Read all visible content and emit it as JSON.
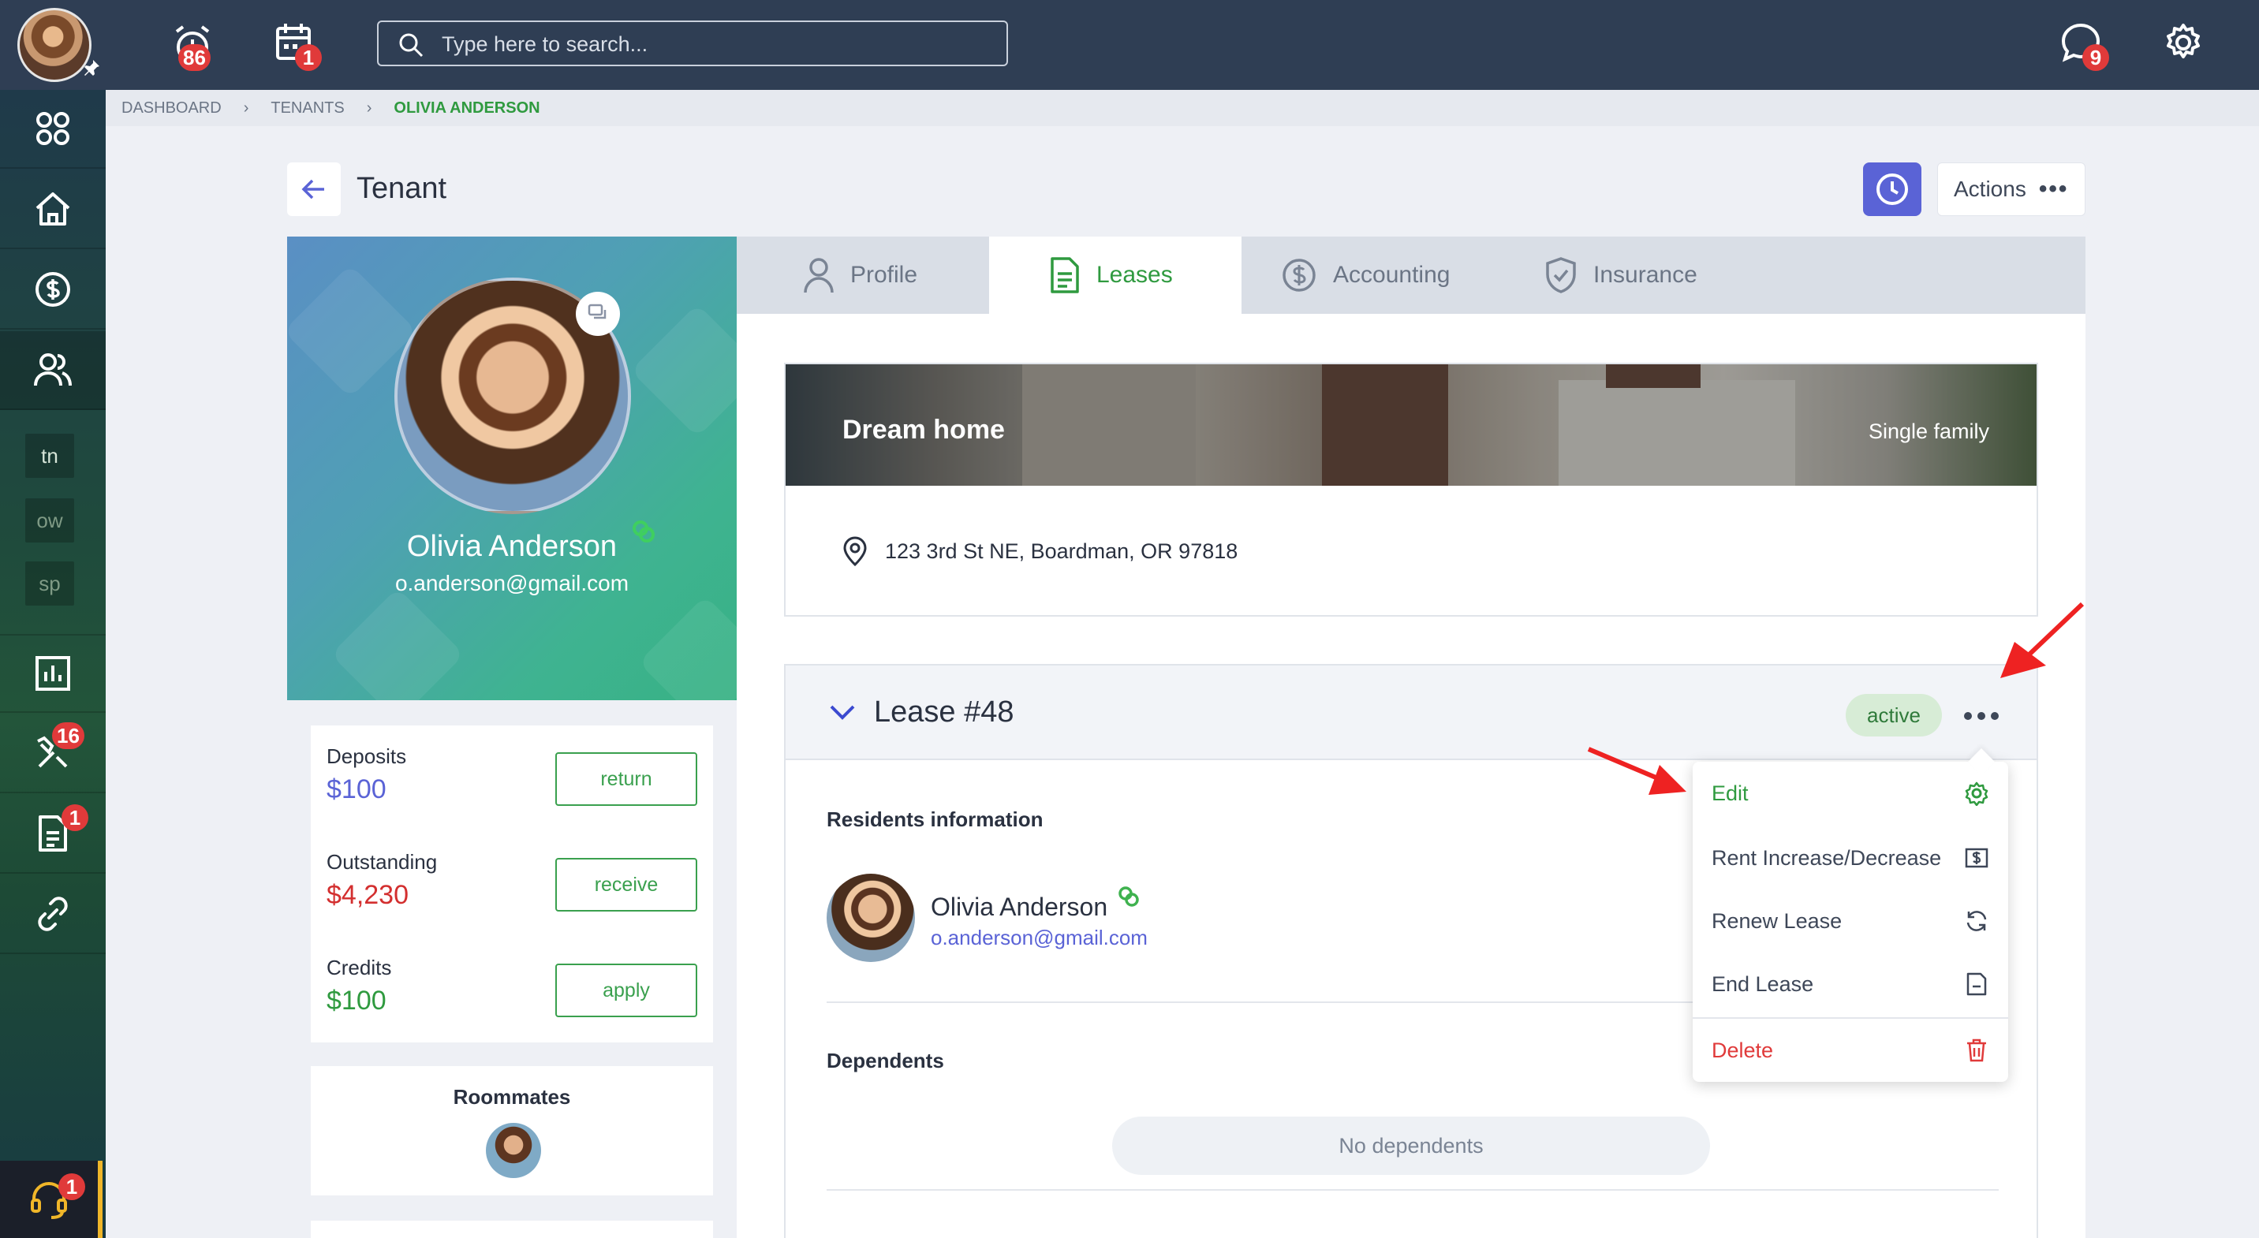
{
  "topbar": {
    "search_placeholder": "Type here to search...",
    "alarm_badge": "86",
    "calendar_badge": "1",
    "chat_badge": "9"
  },
  "sidebar": {
    "small_items": [
      "tn",
      "ow",
      "sp"
    ],
    "tools_badge": "16",
    "docs_badge": "1",
    "help_badge": "1"
  },
  "breadcrumb": [
    "DASHBOARD",
    "TENANTS",
    "OLIVIA ANDERSON"
  ],
  "header": {
    "title": "Tenant",
    "actions_label": "Actions"
  },
  "profile": {
    "name": "Olivia Anderson",
    "email": "o.anderson@gmail.com"
  },
  "finance": [
    {
      "label": "Deposits",
      "value": "$100",
      "color": "#5a63d6",
      "button": "return"
    },
    {
      "label": "Outstanding",
      "value": "$4,230",
      "color": "#d32f2f",
      "button": "receive"
    },
    {
      "label": "Credits",
      "value": "$100",
      "color": "#2f9a3f",
      "button": "apply"
    }
  ],
  "roommates": {
    "title": "Roommates"
  },
  "tabs": [
    "Profile",
    "Leases",
    "Accounting",
    "Insurance"
  ],
  "active_tab": "Leases",
  "property": {
    "name": "Dream home",
    "type": "Single family",
    "address": "123 3rd St NE, Boardman, OR 97818"
  },
  "lease": {
    "title": "Lease #48",
    "status": "active",
    "residents_title": "Residents information",
    "resident_name": "Olivia Anderson",
    "resident_email": "o.anderson@gmail.com",
    "dependents_title": "Dependents",
    "no_dependents": "No dependents"
  },
  "lease_menu": [
    "Edit",
    "Rent Increase/Decrease",
    "Renew Lease",
    "End Lease",
    "Delete"
  ],
  "colors": {
    "topbar": "#2f3e54",
    "accent_green": "#2f9a3f",
    "accent_purple": "#5a63d6",
    "danger": "#e03a3a"
  }
}
